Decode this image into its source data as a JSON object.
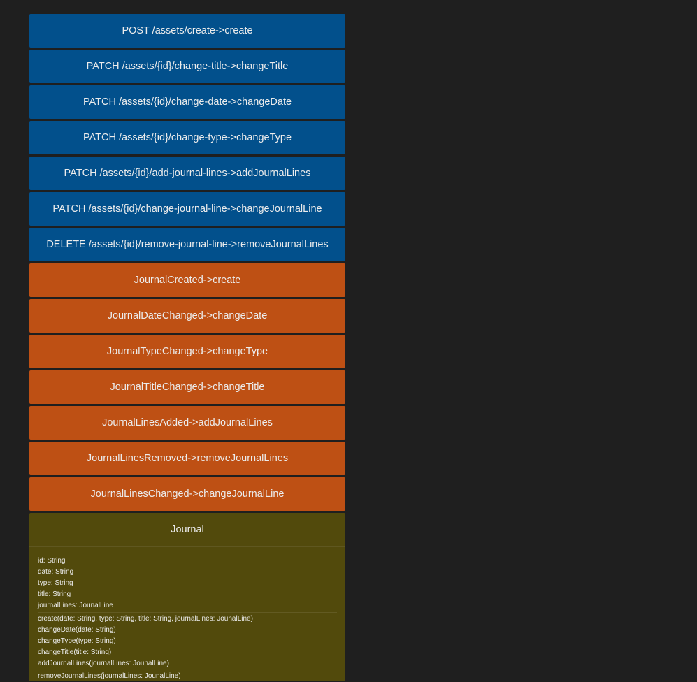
{
  "commands": [
    "POST /assets/create->create",
    "PATCH /assets/{id}/change-title->changeTitle",
    "PATCH /assets/{id}/change-date->changeDate",
    "PATCH /assets/{id}/change-type->changeType",
    "PATCH /assets/{id}/add-journal-lines->addJournalLines",
    "PATCH /assets/{id}/change-journal-line->changeJournalLine",
    "DELETE /assets/{id}/remove-journal-line->removeJournalLines"
  ],
  "events": [
    "JournalCreated->create",
    "JournalDateChanged->changeDate",
    "JournalTypeChanged->changeType",
    "JournalTitleChanged->changeTitle",
    "JournalLinesAdded->addJournalLines",
    "JournalLinesRemoved->removeJournalLines",
    "JournalLinesChanged->changeJournalLine"
  ],
  "aggregate": {
    "title": "Journal",
    "attributes": [
      "id: String",
      "date: String",
      "type: String",
      "title: String",
      "journalLines: JounalLine"
    ],
    "methods": [
      "create(date: String, type: String, title: String, journalLines: JounalLine)",
      "changeDate(date: String)",
      "changeType(type: String)",
      "changeTitle(title: String)",
      "addJournalLines(journalLines: JounalLine)",
      "removeJournalLines(journalLines: JounalLine)"
    ]
  },
  "colors": {
    "background": "#1f1f1f",
    "command": "#02508c",
    "event": "#be5014",
    "aggregate": "#524a0c",
    "text": "#ececec"
  }
}
